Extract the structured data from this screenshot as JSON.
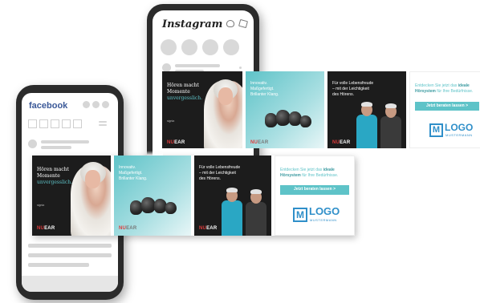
{
  "instagram": {
    "app_name": "Instagram"
  },
  "facebook": {
    "app_name": "facebook"
  },
  "ad": {
    "tile1": {
      "headline_line1": "Hören macht",
      "headline_line2": "Momente",
      "headline_accent": "unvergesslich.",
      "sub_brand": "signia",
      "brand_nu": "NU",
      "brand_ear": "EAR"
    },
    "tile2": {
      "line1": "Innovativ.",
      "line2": "Maßgefertigt.",
      "line3": "Brillanter Klang.",
      "brand_nu": "NU",
      "brand_ear": "EAR"
    },
    "tile3": {
      "line1": "Für volle Lebensfreude",
      "line2": "– mit der Leichtigkeit",
      "line3": "des Hörens.",
      "brand_nu": "NU",
      "brand_ear": "EAR"
    },
    "tile4": {
      "line1_pre": "Entdecken Sie jetzt das ",
      "line1_bold": "ideale",
      "line2_bold": "Hörsystem",
      "line2_post": " für Ihre Bedürfnisse.",
      "button_label": "Jetzt beraten lassen >",
      "logo_mark": "M",
      "logo_word": "LOGO",
      "logo_sub": "MUSTERMANN"
    }
  },
  "colors": {
    "accent": "#5ec3c8",
    "brand_red": "#e03a3a",
    "facebook_blue": "#3b5998",
    "logo_blue": "#2f8fc9",
    "phone_frame": "#2b2b2b"
  }
}
